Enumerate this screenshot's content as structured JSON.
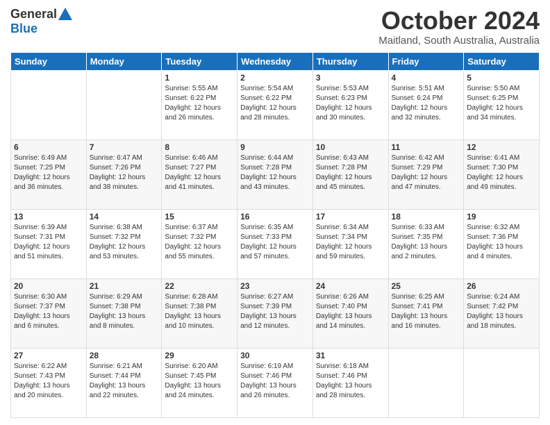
{
  "header": {
    "logo": {
      "general": "General",
      "blue": "Blue"
    },
    "title": "October 2024",
    "location": "Maitland, South Australia, Australia"
  },
  "weekdays": [
    "Sunday",
    "Monday",
    "Tuesday",
    "Wednesday",
    "Thursday",
    "Friday",
    "Saturday"
  ],
  "weeks": [
    [
      {
        "day": null,
        "sunrise": null,
        "sunset": null,
        "daylight": null
      },
      {
        "day": null,
        "sunrise": null,
        "sunset": null,
        "daylight": null
      },
      {
        "day": "1",
        "sunrise": "Sunrise: 5:55 AM",
        "sunset": "Sunset: 6:22 PM",
        "daylight": "Daylight: 12 hours and 26 minutes."
      },
      {
        "day": "2",
        "sunrise": "Sunrise: 5:54 AM",
        "sunset": "Sunset: 6:22 PM",
        "daylight": "Daylight: 12 hours and 28 minutes."
      },
      {
        "day": "3",
        "sunrise": "Sunrise: 5:53 AM",
        "sunset": "Sunset: 6:23 PM",
        "daylight": "Daylight: 12 hours and 30 minutes."
      },
      {
        "day": "4",
        "sunrise": "Sunrise: 5:51 AM",
        "sunset": "Sunset: 6:24 PM",
        "daylight": "Daylight: 12 hours and 32 minutes."
      },
      {
        "day": "5",
        "sunrise": "Sunrise: 5:50 AM",
        "sunset": "Sunset: 6:25 PM",
        "daylight": "Daylight: 12 hours and 34 minutes."
      }
    ],
    [
      {
        "day": "6",
        "sunrise": "Sunrise: 6:49 AM",
        "sunset": "Sunset: 7:25 PM",
        "daylight": "Daylight: 12 hours and 36 minutes."
      },
      {
        "day": "7",
        "sunrise": "Sunrise: 6:47 AM",
        "sunset": "Sunset: 7:26 PM",
        "daylight": "Daylight: 12 hours and 38 minutes."
      },
      {
        "day": "8",
        "sunrise": "Sunrise: 6:46 AM",
        "sunset": "Sunset: 7:27 PM",
        "daylight": "Daylight: 12 hours and 41 minutes."
      },
      {
        "day": "9",
        "sunrise": "Sunrise: 6:44 AM",
        "sunset": "Sunset: 7:28 PM",
        "daylight": "Daylight: 12 hours and 43 minutes."
      },
      {
        "day": "10",
        "sunrise": "Sunrise: 6:43 AM",
        "sunset": "Sunset: 7:28 PM",
        "daylight": "Daylight: 12 hours and 45 minutes."
      },
      {
        "day": "11",
        "sunrise": "Sunrise: 6:42 AM",
        "sunset": "Sunset: 7:29 PM",
        "daylight": "Daylight: 12 hours and 47 minutes."
      },
      {
        "day": "12",
        "sunrise": "Sunrise: 6:41 AM",
        "sunset": "Sunset: 7:30 PM",
        "daylight": "Daylight: 12 hours and 49 minutes."
      }
    ],
    [
      {
        "day": "13",
        "sunrise": "Sunrise: 6:39 AM",
        "sunset": "Sunset: 7:31 PM",
        "daylight": "Daylight: 12 hours and 51 minutes."
      },
      {
        "day": "14",
        "sunrise": "Sunrise: 6:38 AM",
        "sunset": "Sunset: 7:32 PM",
        "daylight": "Daylight: 12 hours and 53 minutes."
      },
      {
        "day": "15",
        "sunrise": "Sunrise: 6:37 AM",
        "sunset": "Sunset: 7:32 PM",
        "daylight": "Daylight: 12 hours and 55 minutes."
      },
      {
        "day": "16",
        "sunrise": "Sunrise: 6:35 AM",
        "sunset": "Sunset: 7:33 PM",
        "daylight": "Daylight: 12 hours and 57 minutes."
      },
      {
        "day": "17",
        "sunrise": "Sunrise: 6:34 AM",
        "sunset": "Sunset: 7:34 PM",
        "daylight": "Daylight: 12 hours and 59 minutes."
      },
      {
        "day": "18",
        "sunrise": "Sunrise: 6:33 AM",
        "sunset": "Sunset: 7:35 PM",
        "daylight": "Daylight: 13 hours and 2 minutes."
      },
      {
        "day": "19",
        "sunrise": "Sunrise: 6:32 AM",
        "sunset": "Sunset: 7:36 PM",
        "daylight": "Daylight: 13 hours and 4 minutes."
      }
    ],
    [
      {
        "day": "20",
        "sunrise": "Sunrise: 6:30 AM",
        "sunset": "Sunset: 7:37 PM",
        "daylight": "Daylight: 13 hours and 6 minutes."
      },
      {
        "day": "21",
        "sunrise": "Sunrise: 6:29 AM",
        "sunset": "Sunset: 7:38 PM",
        "daylight": "Daylight: 13 hours and 8 minutes."
      },
      {
        "day": "22",
        "sunrise": "Sunrise: 6:28 AM",
        "sunset": "Sunset: 7:38 PM",
        "daylight": "Daylight: 13 hours and 10 minutes."
      },
      {
        "day": "23",
        "sunrise": "Sunrise: 6:27 AM",
        "sunset": "Sunset: 7:39 PM",
        "daylight": "Daylight: 13 hours and 12 minutes."
      },
      {
        "day": "24",
        "sunrise": "Sunrise: 6:26 AM",
        "sunset": "Sunset: 7:40 PM",
        "daylight": "Daylight: 13 hours and 14 minutes."
      },
      {
        "day": "25",
        "sunrise": "Sunrise: 6:25 AM",
        "sunset": "Sunset: 7:41 PM",
        "daylight": "Daylight: 13 hours and 16 minutes."
      },
      {
        "day": "26",
        "sunrise": "Sunrise: 6:24 AM",
        "sunset": "Sunset: 7:42 PM",
        "daylight": "Daylight: 13 hours and 18 minutes."
      }
    ],
    [
      {
        "day": "27",
        "sunrise": "Sunrise: 6:22 AM",
        "sunset": "Sunset: 7:43 PM",
        "daylight": "Daylight: 13 hours and 20 minutes."
      },
      {
        "day": "28",
        "sunrise": "Sunrise: 6:21 AM",
        "sunset": "Sunset: 7:44 PM",
        "daylight": "Daylight: 13 hours and 22 minutes."
      },
      {
        "day": "29",
        "sunrise": "Sunrise: 6:20 AM",
        "sunset": "Sunset: 7:45 PM",
        "daylight": "Daylight: 13 hours and 24 minutes."
      },
      {
        "day": "30",
        "sunrise": "Sunrise: 6:19 AM",
        "sunset": "Sunset: 7:46 PM",
        "daylight": "Daylight: 13 hours and 26 minutes."
      },
      {
        "day": "31",
        "sunrise": "Sunrise: 6:18 AM",
        "sunset": "Sunset: 7:46 PM",
        "daylight": "Daylight: 13 hours and 28 minutes."
      },
      {
        "day": null,
        "sunrise": null,
        "sunset": null,
        "daylight": null
      },
      {
        "day": null,
        "sunrise": null,
        "sunset": null,
        "daylight": null
      }
    ]
  ]
}
